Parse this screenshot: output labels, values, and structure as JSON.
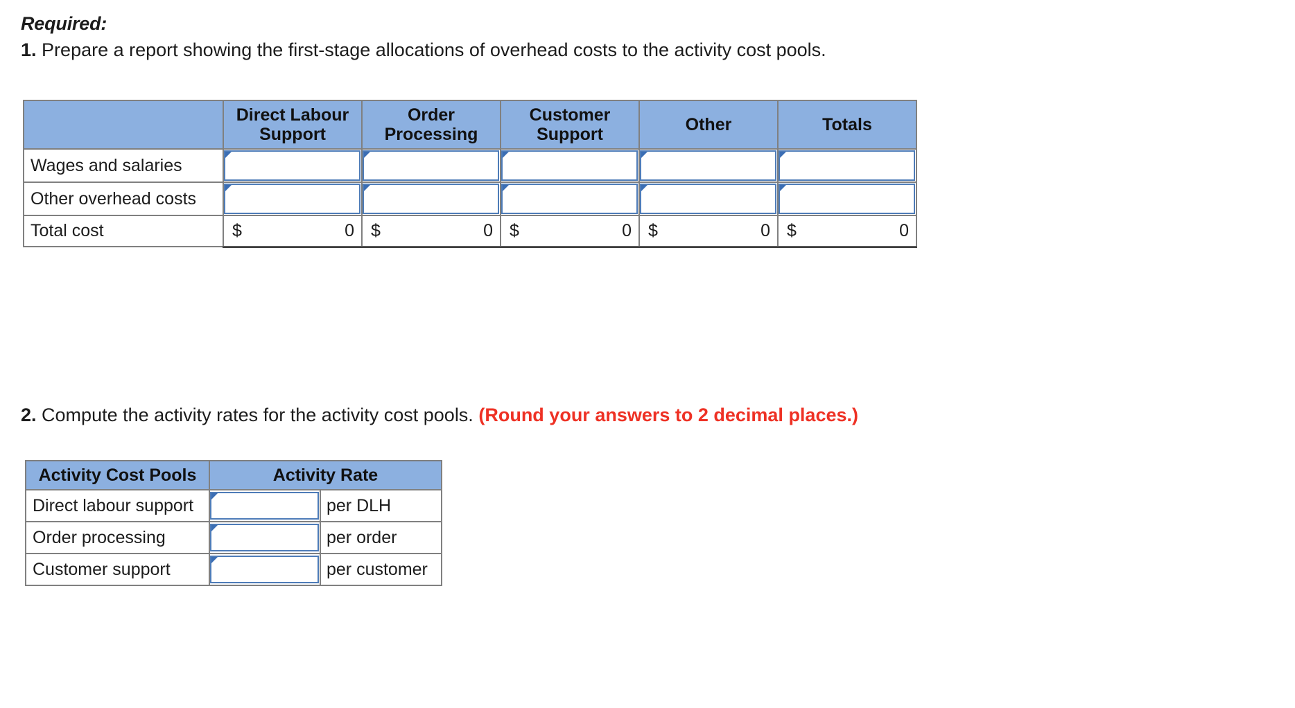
{
  "instructions": {
    "required_label": "Required:",
    "item1_number": "1.",
    "item1_text": "Prepare a report showing the first-stage allocations of overhead costs to the activity cost pools.",
    "item2_number": "2.",
    "item2_text": "Compute the activity rates for the activity cost pools.",
    "item2_note": "(Round your answers to 2 decimal places.)"
  },
  "colors": {
    "header_blue": "#8cb0e0",
    "entry_border_blue": "#4e7cb8",
    "flag_blue": "#3b6eb4",
    "note_red": "#ee3124",
    "grid_gray": "#808080"
  },
  "allocation_table": {
    "name": "first-stage-allocations",
    "headers": [
      "",
      "Direct Labour Support",
      "Order Processing",
      "Customer Support",
      "Other",
      "Totals"
    ],
    "rows": [
      {
        "label": "Wages and salaries",
        "type": "input",
        "values": [
          "",
          "",
          "",
          "",
          ""
        ]
      },
      {
        "label": "Other overhead costs",
        "type": "input",
        "values": [
          "",
          "",
          "",
          "",
          ""
        ]
      },
      {
        "label": "Total cost",
        "type": "total",
        "currency": "$",
        "values": [
          "0",
          "0",
          "0",
          "0",
          "0"
        ]
      }
    ]
  },
  "rates_table": {
    "name": "activity-rates",
    "headers": [
      "Activity Cost Pools",
      "Activity Rate"
    ],
    "rows": [
      {
        "pool": "Direct labour support",
        "rate": "",
        "unit": "per DLH"
      },
      {
        "pool": "Order processing",
        "rate": "",
        "unit": "per order"
      },
      {
        "pool": "Customer support",
        "rate": "",
        "unit": "per customer"
      }
    ]
  }
}
